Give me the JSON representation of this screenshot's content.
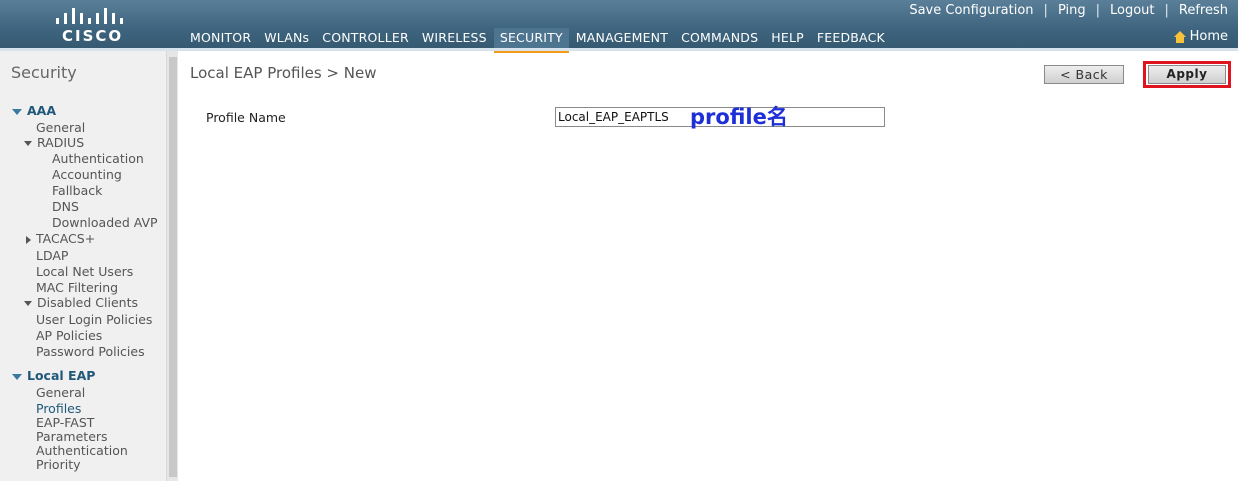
{
  "header": {
    "logo_text": "CISCO",
    "util_links": [
      "Save Configuration",
      "Ping",
      "Logout",
      "Refresh"
    ],
    "nav": [
      "MONITOR",
      "WLANs",
      "CONTROLLER",
      "WIRELESS",
      "SECURITY",
      "MANAGEMENT",
      "COMMANDS",
      "HELP",
      "FEEDBACK"
    ],
    "active_nav": "SECURITY",
    "home_label": "Home",
    "home_icon": "home-icon",
    "accent_color": "#f39c1a"
  },
  "sidebar": {
    "title": "Security",
    "aaa": {
      "label": "AAA",
      "general": "General",
      "radius": "RADIUS",
      "radius_items": [
        "Authentication",
        "Accounting",
        "Fallback",
        "DNS",
        "Downloaded AVP"
      ],
      "tacacs": "TACACS+",
      "ldap": "LDAP",
      "local_net_users": "Local Net Users",
      "mac_filtering": "MAC Filtering",
      "disabled_clients": "Disabled Clients",
      "user_login_policies": "User Login Policies",
      "ap_policies": "AP Policies",
      "password_policies": "Password Policies"
    },
    "local_eap": {
      "label": "Local EAP",
      "items": [
        "General",
        "Profiles",
        "EAP-FAST Parameters",
        "Authentication Priority"
      ],
      "selected": "Profiles"
    }
  },
  "main": {
    "title": "Local EAP Profiles > New",
    "back_label": "< Back",
    "apply_label": "Apply",
    "profile_label": "Profile Name",
    "profile_value": "Local_EAP_EAPTLS",
    "annotation": "profile名",
    "annotation_color": "#1f2fd8",
    "highlight_color": "#e0141f"
  }
}
